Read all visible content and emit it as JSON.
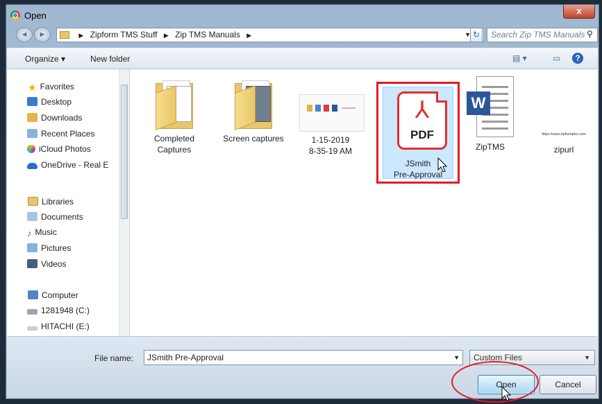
{
  "window": {
    "title": "Open",
    "close_glyph": "x"
  },
  "nav": {
    "back": "◄",
    "forward": "►"
  },
  "address": {
    "crumbs": [
      "Zipform TMS Stuff",
      "Zip TMS Manuals"
    ],
    "separator": "▶",
    "dropdown": "▼"
  },
  "search": {
    "placeholder": "Search Zip TMS Manuals",
    "icon": "search-icon"
  },
  "toolbar": {
    "organize": "Organize ▾",
    "new_folder": "New folder",
    "view_icon": "views-icon",
    "help": "?"
  },
  "sidebar": {
    "favorites_header": "Favorites",
    "favorites": [
      "Desktop",
      "Downloads",
      "Recent Places",
      "iCloud Photos",
      "OneDrive - Real E"
    ],
    "libraries_header": "Libraries",
    "libraries": [
      "Documents",
      "Music",
      "Pictures",
      "Videos"
    ],
    "computer_header": "Computer",
    "drives": [
      "1281948 (C:)",
      "HITACHI (E:)"
    ]
  },
  "files": [
    {
      "name_line1": "Completed",
      "name_line2": "Captures",
      "kind": "folder"
    },
    {
      "name_line1": "Screen captures",
      "name_line2": "",
      "kind": "folder"
    },
    {
      "name_line1": "1-15-2019",
      "name_line2": "8-35-19 AM",
      "kind": "image"
    },
    {
      "name_line1": "JSmith",
      "name_line2": "Pre-Approval",
      "kind": "pdf",
      "badge": "PDF"
    },
    {
      "name_line1": "ZipTMS",
      "name_line2": "",
      "kind": "word",
      "badge": "W"
    },
    {
      "name_line1": "zipurl",
      "name_line2": "",
      "kind": "url",
      "preview": "https://www.zipformplus.com"
    }
  ],
  "bottom": {
    "file_name_label": "File name:",
    "file_name_value": "JSmith Pre-Approval",
    "filter_value": "Custom Files",
    "open_label": "Open",
    "cancel_label": "Cancel"
  },
  "colors": {
    "highlight": "#e31b23",
    "selection": "#cce8ff"
  }
}
